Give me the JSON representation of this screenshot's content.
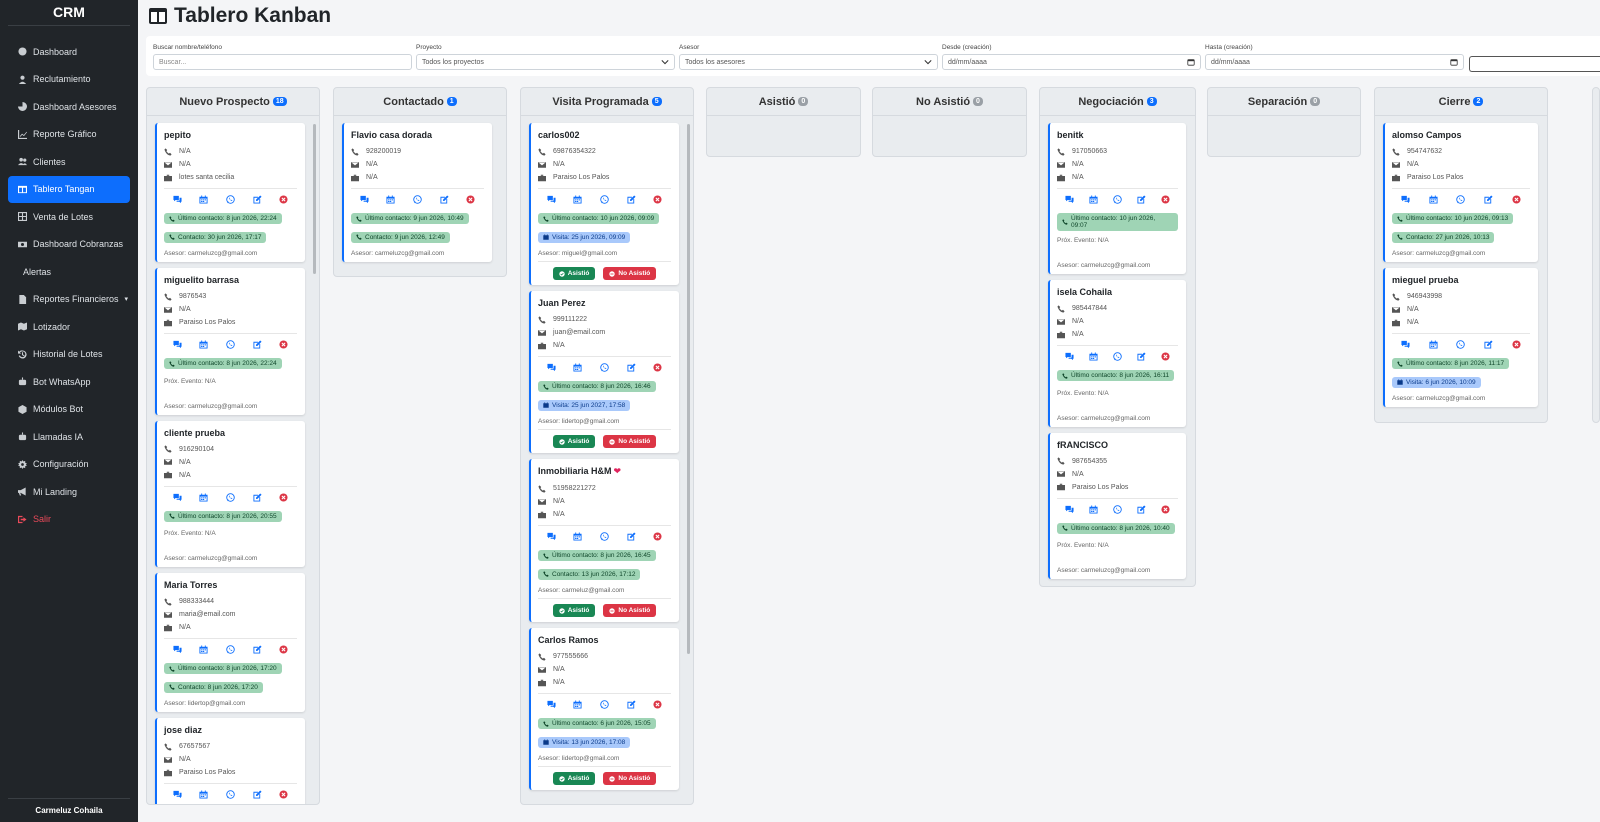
{
  "app": {
    "brand": "CRM",
    "user": "Carmeluz Cohaila"
  },
  "nav": [
    {
      "label": "Dashboard",
      "icon": "gauge-icon"
    },
    {
      "label": "Reclutamiento",
      "icon": "user-tie-icon"
    },
    {
      "label": "Dashboard Asesores",
      "icon": "chart-pie-icon"
    },
    {
      "label": "Reporte Gráfico",
      "icon": "chart-line-icon"
    },
    {
      "label": "Clientes",
      "icon": "users-icon"
    },
    {
      "label": "Tablero Tangan",
      "icon": "columns-icon",
      "active": true
    },
    {
      "label": "Venta de Lotes",
      "icon": "grid-icon"
    },
    {
      "label": "Dashboard Cobranzas",
      "icon": "money-icon"
    },
    {
      "label": "Alertas",
      "icon": ""
    },
    {
      "label": "Reportes Financieros",
      "icon": "file-icon",
      "caret": "▾"
    },
    {
      "label": "Lotizador",
      "icon": "map-icon"
    },
    {
      "label": "Historial de Lotes",
      "icon": "history-icon"
    },
    {
      "label": "Bot WhatsApp",
      "icon": "robot-icon"
    },
    {
      "label": "Módulos Bot",
      "icon": "cube-icon"
    },
    {
      "label": "Llamadas IA",
      "icon": "robot-icon"
    },
    {
      "label": "Configuración",
      "icon": "gear-icon"
    },
    {
      "label": "Mi Landing",
      "icon": "megaphone-icon"
    },
    {
      "label": "Salir",
      "icon": "logout-icon",
      "danger": true
    }
  ],
  "header": {
    "title": "Tablero Kanban"
  },
  "filters": {
    "search_label": "Buscar nombre/teléfono",
    "search_placeholder": "Buscar...",
    "project_label": "Proyecto",
    "project_value": "Todos los proyectos",
    "advisor_label": "Asesor",
    "advisor_value": "Todos los asesores",
    "from_label": "Desde (creación)",
    "from_value": "dd/mm/aaaa",
    "to_label": "Hasta (creación)",
    "to_value": "dd/mm/aaaa"
  },
  "buttons": {
    "asistio": "Asistió",
    "no_asistio": "No Asistió"
  },
  "columns": [
    {
      "title": "Nuevo Prospecto",
      "count": "18",
      "cards": [
        {
          "name": "pepito",
          "phone": "N/A",
          "email": "N/A",
          "project": "lotes santa cecilia",
          "pills": [
            {
              "type": "green",
              "text": "Último contacto: 8 jun 2026, 22:24"
            },
            {
              "type": "green",
              "text": "Contacto: 30 jun 2026, 17:17"
            }
          ],
          "asesor": "Asesor: carmeluzcg@gmail.com"
        },
        {
          "name": "miguelito barrasa",
          "phone": "9876543",
          "email": "N/A",
          "project": "Paraiso Los Palos",
          "pills": [
            {
              "type": "green",
              "text": "Último contacto: 8 jun 2026, 22:24"
            }
          ],
          "prox": "Próx. Evento: N/A",
          "asesor": "Asesor: carmeluzcg@gmail.com"
        },
        {
          "name": "cliente prueba",
          "phone": "916290104",
          "email": "N/A",
          "project": "N/A",
          "pills": [
            {
              "type": "green",
              "text": "Último contacto: 8 jun 2026, 20:55"
            }
          ],
          "prox": "Próx. Evento: N/A",
          "asesor": "Asesor: carmeluzcg@gmail.com"
        },
        {
          "name": "Maria Torres",
          "phone": "988333444",
          "email": "maria@email.com",
          "project": "N/A",
          "pills": [
            {
              "type": "green",
              "text": "Último contacto: 8 jun 2026, 17:20"
            },
            {
              "type": "green",
              "text": "Contacto: 8 jun 2026, 17:20"
            }
          ],
          "asesor": "Asesor: lidertop@gmail.com"
        },
        {
          "name": "jose diaz",
          "phone": "67657567",
          "email": "N/A",
          "project": "Paraiso Los Palos",
          "pills": [],
          "asesor": ""
        }
      ]
    },
    {
      "title": "Contactado",
      "count": "1",
      "cards": [
        {
          "name": "Flavio casa dorada",
          "phone": "928200019",
          "email": "N/A",
          "project": "N/A",
          "pills": [
            {
              "type": "green",
              "text": "Último contacto: 9 jun 2026, 10:49"
            },
            {
              "type": "green",
              "text": "Contacto: 9 jun 2026, 12:49"
            }
          ],
          "asesor": "Asesor: carmeluzcg@gmail.com"
        }
      ]
    },
    {
      "title": "Visita Programada",
      "count": "5",
      "cards": [
        {
          "name": "carlos002",
          "phone": "69876354322",
          "email": "N/A",
          "project": "Paraiso Los Palos",
          "pills": [
            {
              "type": "green",
              "text": "Último contacto: 10 jun 2026, 09:09"
            },
            {
              "type": "blue",
              "text": "Visita: 25 jun 2026, 09:09"
            }
          ],
          "asesor": "Asesor: miguel@gmail.com",
          "attend": true
        },
        {
          "name": "Juan Perez",
          "phone": "999111222",
          "email": "juan@email.com",
          "project": "N/A",
          "pills": [
            {
              "type": "green",
              "text": "Último contacto: 8 jun 2026, 16:46"
            },
            {
              "type": "blue",
              "text": "Visita: 25 jun 2027, 17:58"
            }
          ],
          "asesor": "Asesor: lidertop@gmail.com",
          "attend": true
        },
        {
          "name": "Inmobiliaria H&M",
          "heart": "❤",
          "phone": "51958221272",
          "email": "N/A",
          "project": "N/A",
          "pills": [
            {
              "type": "green",
              "text": "Último contacto: 8 jun 2026, 16:45"
            },
            {
              "type": "green",
              "text": "Contacto: 13 jun 2026, 17:12"
            }
          ],
          "asesor": "Asesor: carmeluz@gmail.com",
          "attend": true
        },
        {
          "name": "Carlos Ramos",
          "phone": "977555666",
          "email": "N/A",
          "project": "N/A",
          "pills": [
            {
              "type": "green",
              "text": "Último contacto: 6 jun 2026, 15:05"
            },
            {
              "type": "blue",
              "text": "Visita: 13 jun 2026, 17:08"
            }
          ],
          "asesor": "Asesor: lidertop@gmail.com",
          "attend": true
        }
      ]
    },
    {
      "title": "Asistió",
      "count": "0",
      "cards": []
    },
    {
      "title": "No Asistió",
      "count": "0",
      "cards": []
    },
    {
      "title": "Negociación",
      "count": "3",
      "cards": [
        {
          "name": "benitk",
          "phone": "917050663",
          "email": "N/A",
          "project": "N/A",
          "pills": [
            {
              "type": "green",
              "text": "Último contacto: 10 jun 2026, 09:07"
            }
          ],
          "prox": "Próx. Evento: N/A",
          "asesor": "Asesor: carmeluzcg@gmail.com"
        },
        {
          "name": "isela Cohaila",
          "phone": "985447844",
          "email": "N/A",
          "project": "N/A",
          "pills": [
            {
              "type": "green",
              "text": "Último contacto: 8 jun 2026, 16:11"
            }
          ],
          "prox": "Próx. Evento: N/A",
          "asesor": "Asesor: carmeluzcg@gmail.com"
        },
        {
          "name": "fRANCISCO",
          "phone": "987654355",
          "email": "N/A",
          "project": "Paraiso Los Palos",
          "pills": [
            {
              "type": "green",
              "text": "Último contacto: 8 jun 2026, 10:40"
            }
          ],
          "prox": "Próx. Evento: N/A",
          "asesor": "Asesor: carmeluzcg@gmail.com"
        }
      ]
    },
    {
      "title": "Separación",
      "count": "0",
      "cards": []
    },
    {
      "title": "Cierre",
      "count": "2",
      "cards": [
        {
          "name": "alomso Campos",
          "phone": "954747632",
          "email": "N/A",
          "project": "Paraiso Los Palos",
          "pills": [
            {
              "type": "green",
              "text": "Último contacto: 10 jun 2026, 09:13"
            },
            {
              "type": "green",
              "text": "Contacto: 27 jun 2026, 10:13"
            }
          ],
          "asesor": "Asesor: carmeluzcg@gmail.com"
        },
        {
          "name": "mieguel prueba",
          "phone": "946943998",
          "email": "N/A",
          "project": "N/A",
          "pills": [
            {
              "type": "green",
              "text": "Último contacto: 8 jun 2026, 11:17"
            },
            {
              "type": "blue",
              "text": "Visita: 6 jun 2026, 10:09"
            }
          ],
          "asesor": "Asesor: carmeluzcg@gmail.com"
        }
      ]
    }
  ],
  "colors": {
    "primary": "#0d6efd",
    "success": "#198754",
    "danger": "#dc3545",
    "sidebar": "#212529",
    "whatsapp": "#0d6efd"
  }
}
